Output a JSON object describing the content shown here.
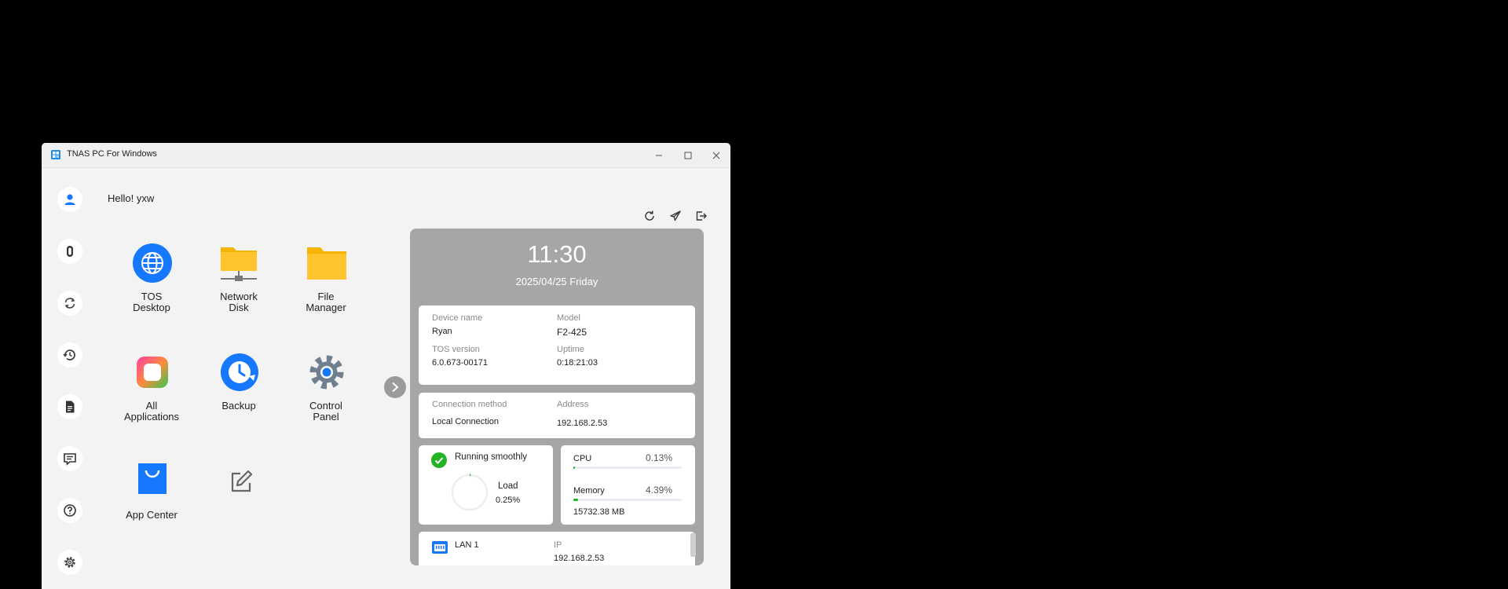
{
  "window": {
    "title": "TNAS PC For Windows"
  },
  "greeting": "Hello! yxw",
  "apps": [
    {
      "label": "TOS Desktop",
      "line1": "TOS",
      "line2": "Desktop",
      "icon": "globe-icon"
    },
    {
      "label": "Network Disk",
      "line1": "Network",
      "line2": "Disk",
      "icon": "network-folder-icon"
    },
    {
      "label": "File Manager",
      "line1": "File",
      "line2": "Manager",
      "icon": "folder-icon"
    },
    {
      "label": "All Applications",
      "line1": "All",
      "line2": "Applications",
      "icon": "all-apps-icon"
    },
    {
      "label": "Backup",
      "line1": "Backup",
      "line2": "",
      "icon": "backup-clock-icon"
    },
    {
      "label": "Control Panel",
      "line1": "Control",
      "line2": "Panel",
      "icon": "gear-icon"
    },
    {
      "label": "App Center",
      "line1": "App Center",
      "line2": "",
      "icon": "shopping-bag-icon"
    }
  ],
  "sidebar_icons": [
    "user-icon",
    "capsule-icon",
    "sync-icon",
    "history-icon",
    "document-icon",
    "message-icon",
    "help-icon",
    "settings-icon"
  ],
  "toolbar_icons": [
    "refresh-icon",
    "send-icon",
    "logout-icon"
  ],
  "status": {
    "time": "11:30",
    "date": "2025/04/25 Friday",
    "device": {
      "name_label": "Device name",
      "name": "Ryan",
      "model_label": "Model",
      "model": "F2-425",
      "tos_label": "TOS version",
      "tos": "6.0.673-00171",
      "uptime_label": "Uptime",
      "uptime": "0:18:21:03"
    },
    "connection": {
      "method_label": "Connection method",
      "method": "Local Connection",
      "address_label": "Address",
      "address": "192.168.2.53"
    },
    "health": {
      "text": "Running smoothly",
      "load_label": "Load",
      "load": "0.25%",
      "load_value": 0.25
    },
    "resources": {
      "cpu_label": "CPU",
      "cpu": "0.13%",
      "cpu_value": 0.13,
      "memory_label": "Memory",
      "memory": "4.39%",
      "memory_value": 4.39,
      "memory_total": "15732.38 MB"
    },
    "lan": {
      "name": "LAN 1",
      "ip_label": "IP",
      "ip": "192.168.2.53"
    }
  },
  "colors": {
    "accent": "#1677ff",
    "success": "#23b324",
    "folder": "#ffc42e",
    "panel": "#a6a6a6"
  }
}
